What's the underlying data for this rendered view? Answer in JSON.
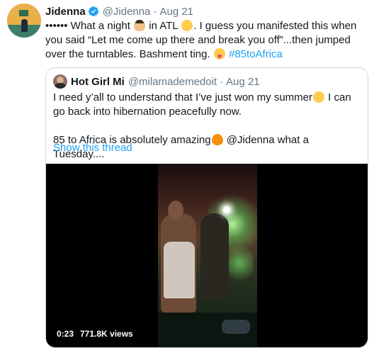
{
  "tweet": {
    "author_name": "Jidenna",
    "author_handle": "@Jidenna",
    "separator": "·",
    "time": "Aug 21",
    "text_part1": "•••••• What a night ",
    "text_part2": " in ATL ",
    "text_part3": ". I guess you manifested this when you said “Let me come up there and break you off”...then jumped over the turntables. Bashment ting. ",
    "hashtag": "#85toAfrica",
    "icons": {
      "verified": "verified-badge-icon",
      "emoji1": "man-face-emoji",
      "emoji2": "rolling-laughing-emoji",
      "emoji3": "tongue-wink-emoji"
    },
    "colors": {
      "link": "#1da1f2",
      "secondary": "#657786",
      "border": "#ccd6dd"
    }
  },
  "quote": {
    "author_name": "Hot Girl Mi",
    "author_handle": "@milamademedoit",
    "separator": "·",
    "time": "Aug 21",
    "para1_part1": "I need y’all to understand that I’ve just won my summer",
    "para1_part2": " I can go back into hibernation peacefully now.",
    "para2_part1": "85 to Africa is absolutely amazing",
    "para2_part2": " @Jidenna what a Tuesday....",
    "show_thread": "Show this thread",
    "icons": {
      "emoji_relieved": "relieved-face-emoji",
      "emoji_fire": "fire-emoji"
    }
  },
  "video": {
    "duration": "0:23",
    "views": "771.8K views"
  }
}
